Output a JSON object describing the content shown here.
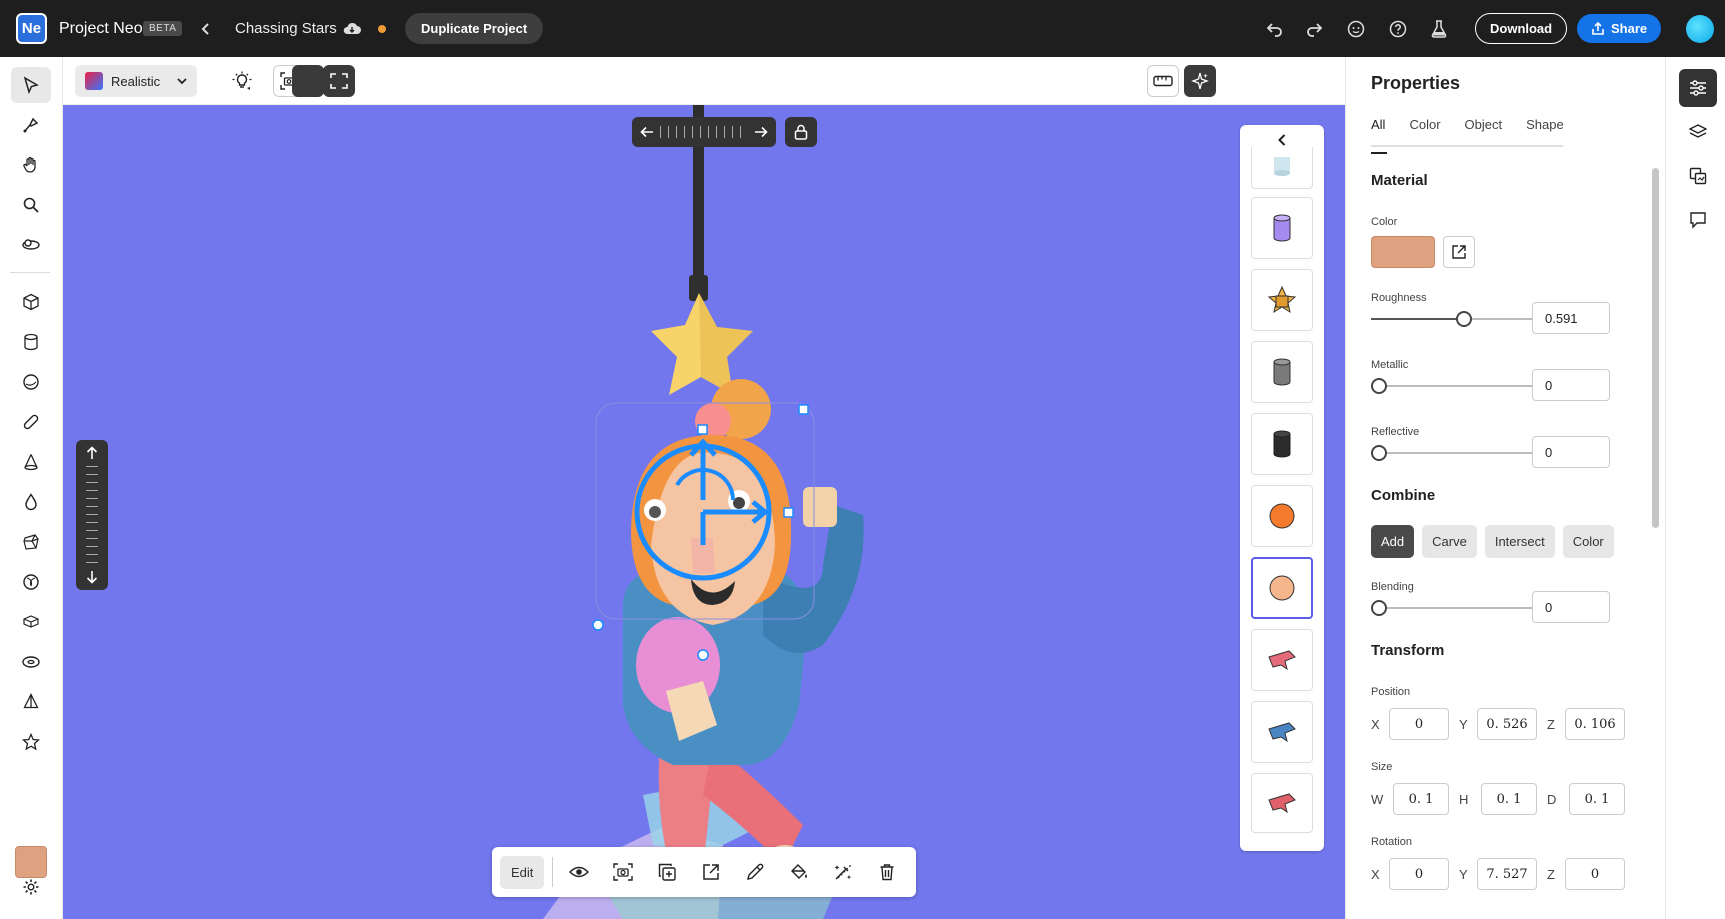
{
  "app": {
    "logo": "Ne",
    "name": "Project Neo",
    "badge": "BETA"
  },
  "project": {
    "name": "Chassing Stars",
    "duplicate_label": "Duplicate Project"
  },
  "header_actions": {
    "download": "Download",
    "share": "Share"
  },
  "render_mode": {
    "selected": "Realistic"
  },
  "action_bar": {
    "edit_label": "Edit"
  },
  "properties": {
    "title": "Properties",
    "tabs": [
      "All",
      "Color",
      "Object",
      "Shape"
    ],
    "active_tab": "All",
    "material": {
      "heading": "Material",
      "color_label": "Color",
      "color_value": "#dfa281",
      "roughness_label": "Roughness",
      "roughness_value": "0.591",
      "metallic_label": "Metallic",
      "metallic_value": "0",
      "reflective_label": "Reflective",
      "reflective_value": "0"
    },
    "combine": {
      "heading": "Combine",
      "options": [
        "Add",
        "Carve",
        "Intersect",
        "Color"
      ],
      "selected": "Add",
      "blending_label": "Blending",
      "blending_value": "0"
    },
    "transform": {
      "heading": "Transform",
      "position_label": "Position",
      "position": {
        "x": "0",
        "y": "0. 526",
        "z": "0. 106"
      },
      "size_label": "Size",
      "size": {
        "w": "0. 1",
        "h": "0. 1",
        "d": "0. 1"
      },
      "rotation_label": "Rotation",
      "rotation": {
        "x": "0",
        "y": "7. 527",
        "z": "0"
      }
    }
  },
  "axis_labels": {
    "x": "X",
    "y": "Y",
    "z": "Z",
    "w": "W",
    "h": "H",
    "d": "D"
  },
  "colors": {
    "canvas": "#7377ee",
    "accent": "#1473e6",
    "selected_color": "#dfa281",
    "unsaved_dot": "#f29b38"
  }
}
